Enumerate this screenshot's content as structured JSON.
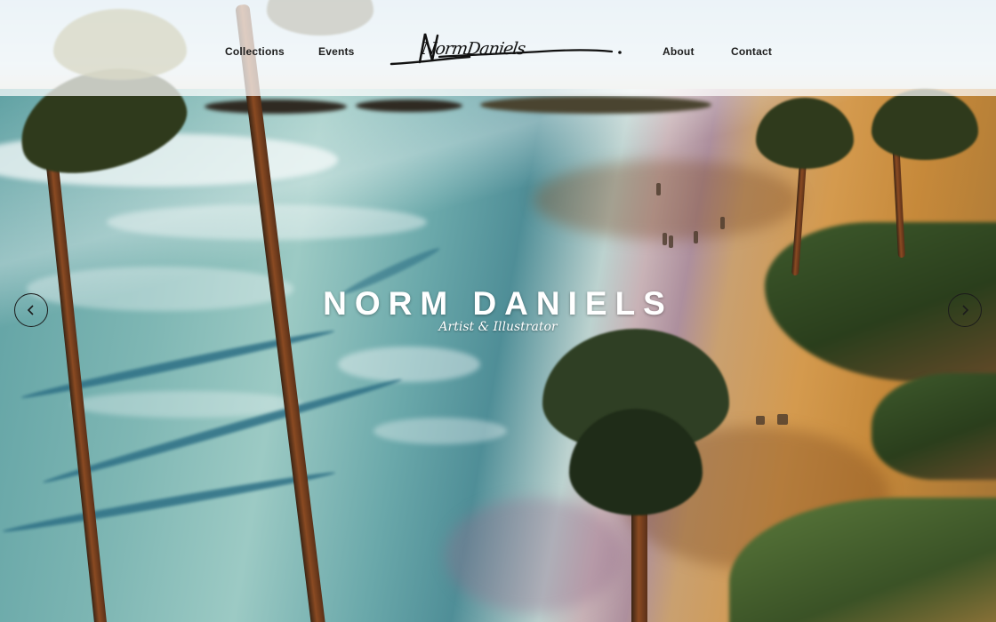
{
  "header": {
    "nav_left": [
      {
        "label": "Collections"
      },
      {
        "label": "Events"
      }
    ],
    "logo_text": "NormDaniels",
    "nav_right": [
      {
        "label": "About"
      },
      {
        "label": "Contact"
      }
    ]
  },
  "hero": {
    "title": "NORM DANIELS",
    "subtitle": "Artist & Illustrator",
    "background": "beach-painting-image",
    "prev_icon": "chevron-left-icon",
    "next_icon": "chevron-right-icon"
  },
  "colors": {
    "header_bg": "#ffffff",
    "nav_text": "#1d1d1d",
    "hero_text": "#ffffff"
  }
}
